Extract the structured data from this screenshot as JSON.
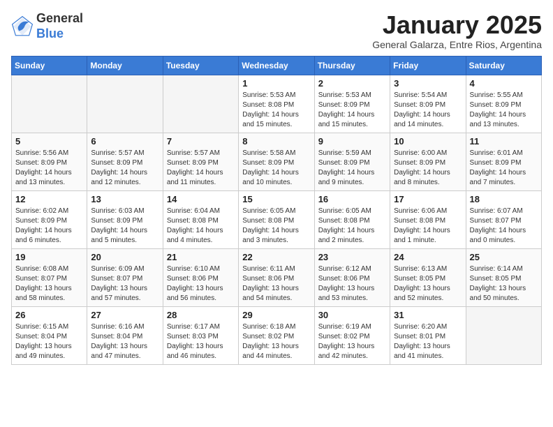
{
  "header": {
    "logo_general": "General",
    "logo_blue": "Blue",
    "month_title": "January 2025",
    "subtitle": "General Galarza, Entre Rios, Argentina"
  },
  "days_of_week": [
    "Sunday",
    "Monday",
    "Tuesday",
    "Wednesday",
    "Thursday",
    "Friday",
    "Saturday"
  ],
  "weeks": [
    [
      {
        "num": "",
        "info": ""
      },
      {
        "num": "",
        "info": ""
      },
      {
        "num": "",
        "info": ""
      },
      {
        "num": "1",
        "info": "Sunrise: 5:53 AM\nSunset: 8:08 PM\nDaylight: 14 hours\nand 15 minutes."
      },
      {
        "num": "2",
        "info": "Sunrise: 5:53 AM\nSunset: 8:09 PM\nDaylight: 14 hours\nand 15 minutes."
      },
      {
        "num": "3",
        "info": "Sunrise: 5:54 AM\nSunset: 8:09 PM\nDaylight: 14 hours\nand 14 minutes."
      },
      {
        "num": "4",
        "info": "Sunrise: 5:55 AM\nSunset: 8:09 PM\nDaylight: 14 hours\nand 13 minutes."
      }
    ],
    [
      {
        "num": "5",
        "info": "Sunrise: 5:56 AM\nSunset: 8:09 PM\nDaylight: 14 hours\nand 13 minutes."
      },
      {
        "num": "6",
        "info": "Sunrise: 5:57 AM\nSunset: 8:09 PM\nDaylight: 14 hours\nand 12 minutes."
      },
      {
        "num": "7",
        "info": "Sunrise: 5:57 AM\nSunset: 8:09 PM\nDaylight: 14 hours\nand 11 minutes."
      },
      {
        "num": "8",
        "info": "Sunrise: 5:58 AM\nSunset: 8:09 PM\nDaylight: 14 hours\nand 10 minutes."
      },
      {
        "num": "9",
        "info": "Sunrise: 5:59 AM\nSunset: 8:09 PM\nDaylight: 14 hours\nand 9 minutes."
      },
      {
        "num": "10",
        "info": "Sunrise: 6:00 AM\nSunset: 8:09 PM\nDaylight: 14 hours\nand 8 minutes."
      },
      {
        "num": "11",
        "info": "Sunrise: 6:01 AM\nSunset: 8:09 PM\nDaylight: 14 hours\nand 7 minutes."
      }
    ],
    [
      {
        "num": "12",
        "info": "Sunrise: 6:02 AM\nSunset: 8:09 PM\nDaylight: 14 hours\nand 6 minutes."
      },
      {
        "num": "13",
        "info": "Sunrise: 6:03 AM\nSunset: 8:09 PM\nDaylight: 14 hours\nand 5 minutes."
      },
      {
        "num": "14",
        "info": "Sunrise: 6:04 AM\nSunset: 8:08 PM\nDaylight: 14 hours\nand 4 minutes."
      },
      {
        "num": "15",
        "info": "Sunrise: 6:05 AM\nSunset: 8:08 PM\nDaylight: 14 hours\nand 3 minutes."
      },
      {
        "num": "16",
        "info": "Sunrise: 6:05 AM\nSunset: 8:08 PM\nDaylight: 14 hours\nand 2 minutes."
      },
      {
        "num": "17",
        "info": "Sunrise: 6:06 AM\nSunset: 8:08 PM\nDaylight: 14 hours\nand 1 minute."
      },
      {
        "num": "18",
        "info": "Sunrise: 6:07 AM\nSunset: 8:07 PM\nDaylight: 14 hours\nand 0 minutes."
      }
    ],
    [
      {
        "num": "19",
        "info": "Sunrise: 6:08 AM\nSunset: 8:07 PM\nDaylight: 13 hours\nand 58 minutes."
      },
      {
        "num": "20",
        "info": "Sunrise: 6:09 AM\nSunset: 8:07 PM\nDaylight: 13 hours\nand 57 minutes."
      },
      {
        "num": "21",
        "info": "Sunrise: 6:10 AM\nSunset: 8:06 PM\nDaylight: 13 hours\nand 56 minutes."
      },
      {
        "num": "22",
        "info": "Sunrise: 6:11 AM\nSunset: 8:06 PM\nDaylight: 13 hours\nand 54 minutes."
      },
      {
        "num": "23",
        "info": "Sunrise: 6:12 AM\nSunset: 8:06 PM\nDaylight: 13 hours\nand 53 minutes."
      },
      {
        "num": "24",
        "info": "Sunrise: 6:13 AM\nSunset: 8:05 PM\nDaylight: 13 hours\nand 52 minutes."
      },
      {
        "num": "25",
        "info": "Sunrise: 6:14 AM\nSunset: 8:05 PM\nDaylight: 13 hours\nand 50 minutes."
      }
    ],
    [
      {
        "num": "26",
        "info": "Sunrise: 6:15 AM\nSunset: 8:04 PM\nDaylight: 13 hours\nand 49 minutes."
      },
      {
        "num": "27",
        "info": "Sunrise: 6:16 AM\nSunset: 8:04 PM\nDaylight: 13 hours\nand 47 minutes."
      },
      {
        "num": "28",
        "info": "Sunrise: 6:17 AM\nSunset: 8:03 PM\nDaylight: 13 hours\nand 46 minutes."
      },
      {
        "num": "29",
        "info": "Sunrise: 6:18 AM\nSunset: 8:02 PM\nDaylight: 13 hours\nand 44 minutes."
      },
      {
        "num": "30",
        "info": "Sunrise: 6:19 AM\nSunset: 8:02 PM\nDaylight: 13 hours\nand 42 minutes."
      },
      {
        "num": "31",
        "info": "Sunrise: 6:20 AM\nSunset: 8:01 PM\nDaylight: 13 hours\nand 41 minutes."
      },
      {
        "num": "",
        "info": ""
      }
    ]
  ]
}
